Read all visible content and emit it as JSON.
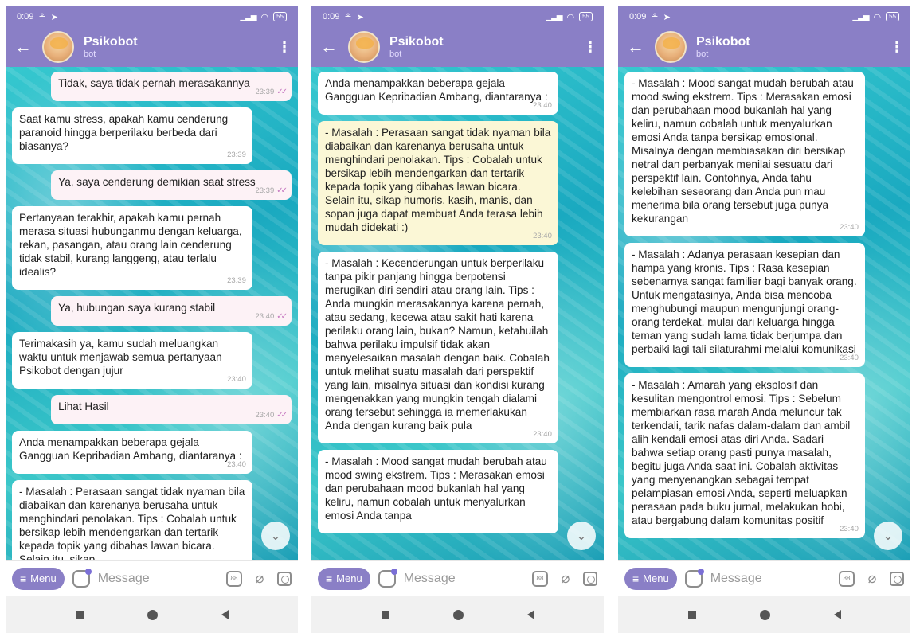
{
  "status": {
    "time": "0:09",
    "battery": "55"
  },
  "bot": {
    "name": "Psikobot",
    "subtitle": "bot"
  },
  "composer": {
    "menu_label": "Menu",
    "placeholder": "Message"
  },
  "screens": [
    {
      "messages": [
        {
          "dir": "out",
          "text": "Tidak, saya tidak pernah merasakannya",
          "time": "23:39",
          "read": true
        },
        {
          "dir": "in",
          "text": "Saat kamu stress, apakah kamu cenderung paranoid hingga berperilaku berbeda dari biasanya?",
          "time": "23:39"
        },
        {
          "dir": "out",
          "text": "Ya, saya cenderung demikian saat stress",
          "time": "23:39",
          "read": true
        },
        {
          "dir": "in",
          "text": "Pertanyaan terakhir, apakah kamu pernah merasa situasi hubunganmu dengan keluarga, rekan, pasangan, atau orang lain cenderung tidak stabil, kurang langgeng, atau terlalu idealis?",
          "time": "23:39"
        },
        {
          "dir": "out",
          "text": "Ya, hubungan saya kurang stabil",
          "time": "23:40",
          "read": true
        },
        {
          "dir": "in",
          "text": "Terimakasih ya, kamu sudah meluangkan waktu untuk menjawab semua pertanyaan Psikobot dengan jujur",
          "time": "23:40"
        },
        {
          "dir": "out",
          "text": "Lihat Hasil",
          "time": "23:40",
          "read": true
        },
        {
          "dir": "in",
          "text": "Anda menampakkan beberapa gejala Gangguan Kepribadian Ambang, diantaranya :",
          "time": "23:40"
        },
        {
          "dir": "in",
          "text": "- Masalah : Perasaan sangat tidak nyaman bila diabaikan dan karenanya berusaha untuk menghindari penolakan. Tips : Cobalah untuk bersikap lebih mendengarkan dan tertarik kepada topik yang dibahas lawan bicara. Selain itu, sikap",
          "time": ""
        }
      ]
    },
    {
      "messages": [
        {
          "dir": "in",
          "text": "Anda menampakkan beberapa gejala Gangguan Kepribadian Ambang, diantaranya :",
          "time": "23:40"
        },
        {
          "dir": "in",
          "highlight": true,
          "text": "- Masalah : Perasaan sangat tidak nyaman bila diabaikan dan karenanya berusaha untuk menghindari penolakan. Tips : Cobalah untuk bersikap lebih mendengarkan dan tertarik kepada topik yang dibahas lawan bicara. Selain itu, sikap humoris, kasih, manis, dan sopan juga dapat membuat Anda terasa lebih mudah didekati :)",
          "time": "23:40"
        },
        {
          "dir": "in",
          "text": "- Masalah : Kecenderungan untuk berperilaku tanpa pikir panjang hingga berpotensi merugikan diri sendiri atau orang lain. Tips : Anda mungkin merasakannya karena pernah, atau sedang, kecewa atau sakit hati karena perilaku orang lain, bukan? Namun, ketahuilah bahwa perilaku impulsif tidak akan menyelesaikan masalah dengan baik. Cobalah untuk melihat suatu masalah dari perspektif yang lain, misalnya situasi dan kondisi kurang mengenakkan yang mungkin tengah dialami orang tersebut sehingga ia memerlakukan Anda dengan kurang baik pula",
          "time": "23:40"
        },
        {
          "dir": "in",
          "text": "- Masalah : Mood sangat mudah berubah atau mood swing ekstrem. Tips : Merasakan emosi dan perubahaan mood bukanlah hal yang keliru, namun cobalah untuk menyalurkan emosi Anda tanpa",
          "time": ""
        }
      ]
    },
    {
      "messages": [
        {
          "dir": "in",
          "text": "- Masalah : Mood sangat mudah berubah atau mood swing ekstrem. Tips : Merasakan emosi dan perubahaan mood bukanlah hal yang keliru, namun cobalah untuk menyalurkan emosi Anda tanpa bersikap emosional. Misalnya dengan membiasakan diri bersikap netral dan perbanyak menilai sesuatu dari perspektif lain. Contohnya, Anda tahu kelebihan seseorang dan Anda pun mau menerima bila orang tersebut juga punya kekurangan",
          "time": "23:40"
        },
        {
          "dir": "in",
          "text": "- Masalah : Adanya perasaan kesepian dan hampa yang kronis. Tips : Rasa kesepian sebenarnya sangat familier bagi banyak orang. Untuk mengatasinya, Anda bisa mencoba menghubungi maupun mengunjungi orang-orang terdekat, mulai dari keluarga hingga teman yang sudah lama tidak berjumpa dan perbaiki lagi tali silaturahmi melalui komunikasi",
          "time": "23:40"
        },
        {
          "dir": "in",
          "text": "- Masalah : Amarah yang eksplosif dan kesulitan mengontrol emosi. Tips : Sebelum membiarkan rasa marah Anda meluncur tak terkendali, tarik nafas dalam-dalam dan ambil alih kendali emosi atas diri Anda. Sadari bahwa setiap orang pasti punya masalah, begitu juga Anda saat ini. Cobalah aktivitas yang menyenangkan sebagai tempat pelampiasan emosi Anda, seperti meluapkan perasaan pada buku jurnal, melakukan hobi, atau bergabung dalam komunitas positif",
          "time": "23:40"
        }
      ]
    }
  ]
}
